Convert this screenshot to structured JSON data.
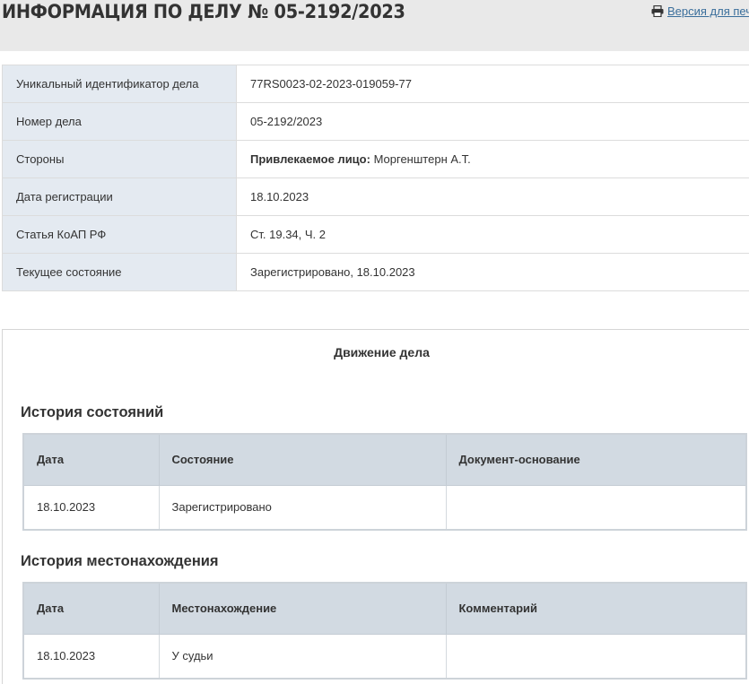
{
  "header": {
    "title": "ИНФОРМАЦИЯ ПО ДЕЛУ № 05-2192/2023",
    "print_link": "Версия для печати"
  },
  "case_info": [
    {
      "label": "Уникальный идентификатор дела",
      "value": "77RS0023-02-2023-019059-77"
    },
    {
      "label": "Номер дела",
      "value": "05-2192/2023"
    },
    {
      "label": "Стороны",
      "value_prefix": "Привлекаемое лицо:",
      "value": " Моргенштерн А.Т."
    },
    {
      "label": "Дата регистрации",
      "value": "18.10.2023"
    },
    {
      "label": "Статья КоАП РФ",
      "value": "Ст. 19.34, Ч. 2"
    },
    {
      "label": "Текущее состояние",
      "value": "Зарегистрировано, 18.10.2023"
    }
  ],
  "movement": {
    "title": "Движение дела",
    "state_history": {
      "heading": "История состояний",
      "columns": [
        "Дата",
        "Состояние",
        "Документ-основание"
      ],
      "rows": [
        [
          "18.10.2023",
          "Зарегистрировано",
          ""
        ]
      ]
    },
    "location_history": {
      "heading": "История местонахождения",
      "columns": [
        "Дата",
        "Местонахождение",
        "Комментарий"
      ],
      "rows": [
        [
          "18.10.2023",
          "У судьи",
          ""
        ]
      ]
    }
  }
}
